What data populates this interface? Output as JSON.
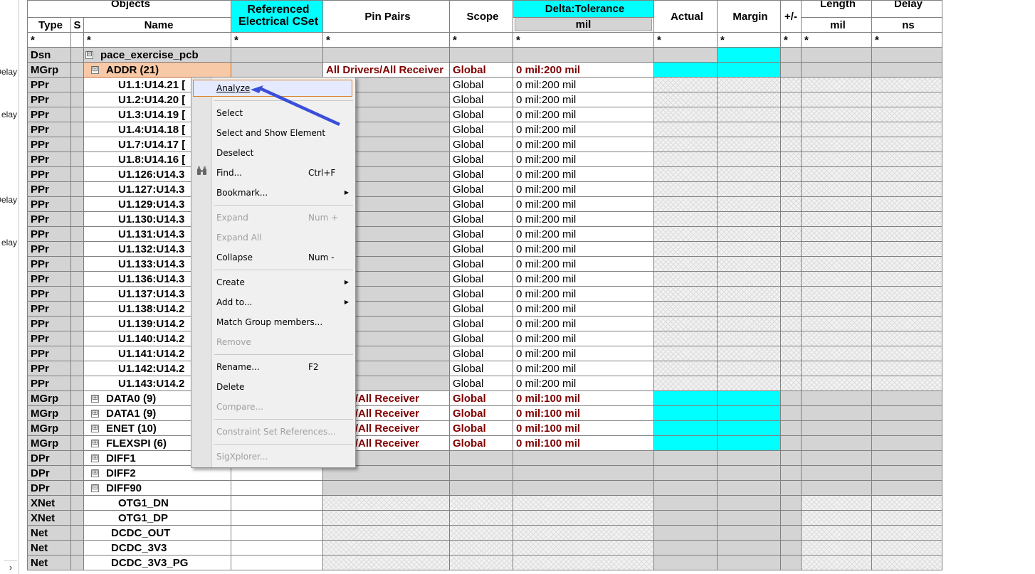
{
  "left_strip": {
    "labels": [
      "Delay",
      "elay",
      "Delay",
      "elay"
    ],
    "scroll_arrow": "›"
  },
  "header": {
    "objects": "Objects",
    "referenced": "Referenced Electrical CSet",
    "pin_pairs": "Pin Pairs",
    "scope": "Scope",
    "delta_tolerance": "Delta:Tolerance",
    "actual": "Actual",
    "margin": "Margin",
    "plus_minus": "+/-",
    "length": "Length",
    "delay": "Delay",
    "type": "Type",
    "s": "S",
    "name": "Name",
    "mil_units": "mil",
    "length_units": "mil",
    "delay_units": "ns",
    "filter": "*"
  },
  "rows": {
    "dsn": {
      "type": "Dsn",
      "name": "pace_exercise_pcb",
      "expander": "⊟"
    },
    "addr": {
      "type": "MGrp",
      "name": "ADDR (21)",
      "expander": "⊟",
      "pin_pairs": "All Drivers/All Receiver",
      "scope": "Global",
      "tol": "0 mil:200 mil"
    },
    "ppr": [
      {
        "type": "PPr",
        "name": "U1.1:U14.21 [",
        "scope": "Global",
        "tol": "0 mil:200 mil"
      },
      {
        "type": "PPr",
        "name": "U1.2:U14.20 [",
        "scope": "Global",
        "tol": "0 mil:200 mil"
      },
      {
        "type": "PPr",
        "name": "U1.3:U14.19 [",
        "scope": "Global",
        "tol": "0 mil:200 mil"
      },
      {
        "type": "PPr",
        "name": "U1.4:U14.18 [",
        "scope": "Global",
        "tol": "0 mil:200 mil"
      },
      {
        "type": "PPr",
        "name": "U1.7:U14.17 [",
        "scope": "Global",
        "tol": "0 mil:200 mil"
      },
      {
        "type": "PPr",
        "name": "U1.8:U14.16 [",
        "scope": "Global",
        "tol": "0 mil:200 mil"
      },
      {
        "type": "PPr",
        "name": "U1.126:U14.3",
        "scope": "Global",
        "tol": "0 mil:200 mil"
      },
      {
        "type": "PPr",
        "name": "U1.127:U14.3",
        "scope": "Global",
        "tol": "0 mil:200 mil"
      },
      {
        "type": "PPr",
        "name": "U1.129:U14.3",
        "scope": "Global",
        "tol": "0 mil:200 mil"
      },
      {
        "type": "PPr",
        "name": "U1.130:U14.3",
        "scope": "Global",
        "tol": "0 mil:200 mil"
      },
      {
        "type": "PPr",
        "name": "U1.131:U14.3",
        "scope": "Global",
        "tol": "0 mil:200 mil"
      },
      {
        "type": "PPr",
        "name": "U1.132:U14.3",
        "scope": "Global",
        "tol": "0 mil:200 mil"
      },
      {
        "type": "PPr",
        "name": "U1.133:U14.3",
        "scope": "Global",
        "tol": "0 mil:200 mil"
      },
      {
        "type": "PPr",
        "name": "U1.136:U14.3",
        "scope": "Global",
        "tol": "0 mil:200 mil"
      },
      {
        "type": "PPr",
        "name": "U1.137:U14.3",
        "scope": "Global",
        "tol": "0 mil:200 mil"
      },
      {
        "type": "PPr",
        "name": "U1.138:U14.2",
        "scope": "Global",
        "tol": "0 mil:200 mil"
      },
      {
        "type": "PPr",
        "name": "U1.139:U14.2",
        "scope": "Global",
        "tol": "0 mil:200 mil"
      },
      {
        "type": "PPr",
        "name": "U1.140:U14.2",
        "scope": "Global",
        "tol": "0 mil:200 mil"
      },
      {
        "type": "PPr",
        "name": "U1.141:U14.2",
        "scope": "Global",
        "tol": "0 mil:200 mil"
      },
      {
        "type": "PPr",
        "name": "U1.142:U14.2",
        "scope": "Global",
        "tol": "0 mil:200 mil"
      },
      {
        "type": "PPr",
        "name": "U1.143:U14.2",
        "scope": "Global",
        "tol": "0 mil:200 mil"
      }
    ],
    "mgrp": [
      {
        "type": "MGrp",
        "name": "DATA0 (9)",
        "expander": "⊞",
        "pin_pairs": "rivers/All Receiver",
        "scope": "Global",
        "tol": "0 mil:100 mil"
      },
      {
        "type": "MGrp",
        "name": "DATA1 (9)",
        "expander": "⊞",
        "pin_pairs": "rivers/All Receiver",
        "scope": "Global",
        "tol": "0 mil:100 mil"
      },
      {
        "type": "MGrp",
        "name": "ENET (10)",
        "expander": "⊞",
        "pin_pairs": "rivers/All Receiver",
        "scope": "Global",
        "tol": "0 mil:100 mil"
      },
      {
        "type": "MGrp",
        "name": "FLEXSPI (6)",
        "expander": "⊞",
        "pin_pairs": "rivers/All Receiver",
        "scope": "Global",
        "tol": "0 mil:100 mil"
      }
    ],
    "dpr": [
      {
        "type": "DPr",
        "name": "DIFF1",
        "expander": "⊞"
      },
      {
        "type": "DPr",
        "name": "DIFF2",
        "expander": "⊞"
      },
      {
        "type": "DPr",
        "name": "DIFF90",
        "expander": "⊟"
      }
    ],
    "nets": [
      {
        "type": "XNet",
        "name": "OTG1_DN"
      },
      {
        "type": "XNet",
        "name": "OTG1_DP"
      },
      {
        "type": "Net",
        "name": "DCDC_OUT"
      },
      {
        "type": "Net",
        "name": "DCDC_3V3"
      },
      {
        "type": "Net",
        "name": "DCDC_3V3_PG"
      }
    ]
  },
  "context_menu": {
    "analyze": "Analyze",
    "select": "Select",
    "select_show": "Select and Show Element",
    "deselect": "Deselect",
    "find": "Find...",
    "find_shortcut": "Ctrl+F",
    "bookmark": "Bookmark...",
    "expand": "Expand",
    "expand_shortcut": "Num +",
    "expand_all": "Expand All",
    "collapse": "Collapse",
    "collapse_shortcut": "Num -",
    "create": "Create",
    "add_to": "Add to...",
    "match_group": "Match Group members...",
    "remove": "Remove",
    "rename": "Rename...",
    "rename_shortcut": "F2",
    "delete": "Delete",
    "compare": "Compare...",
    "cset_refs": "Constraint Set References...",
    "sigxplorer": "SigXplorer..."
  },
  "colors": {
    "accent_cyan": "#00ffff",
    "value_red": "#800000",
    "selected_orange": "#f8c9a6",
    "annotation_arrow": "#3a4fd9"
  }
}
